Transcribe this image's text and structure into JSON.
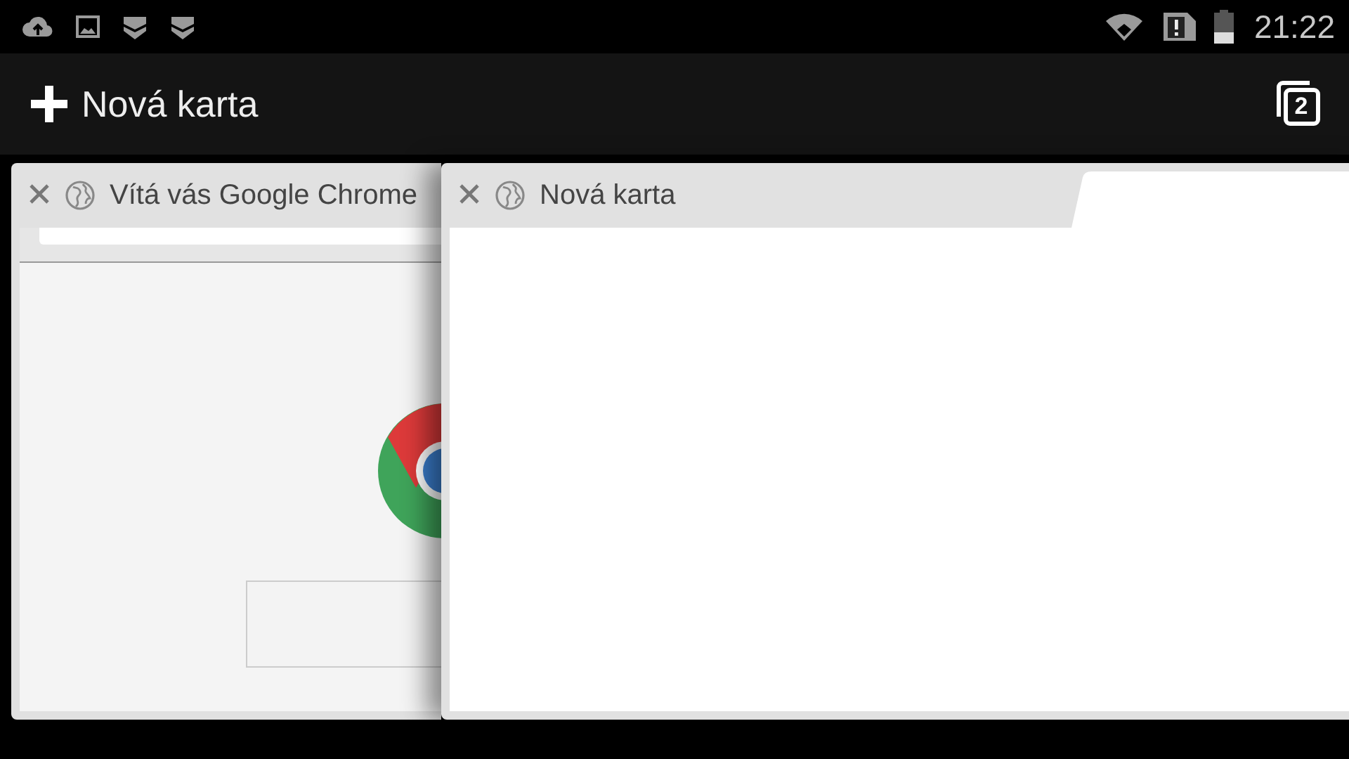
{
  "status_bar": {
    "time": "21:22"
  },
  "toolbar": {
    "new_tab_label": "Nová karta",
    "tab_count": "2"
  },
  "tabs": [
    {
      "title": "Vítá vás Google Chrome",
      "kind": "welcome"
    },
    {
      "title": "Nová karta",
      "kind": "blank"
    }
  ]
}
